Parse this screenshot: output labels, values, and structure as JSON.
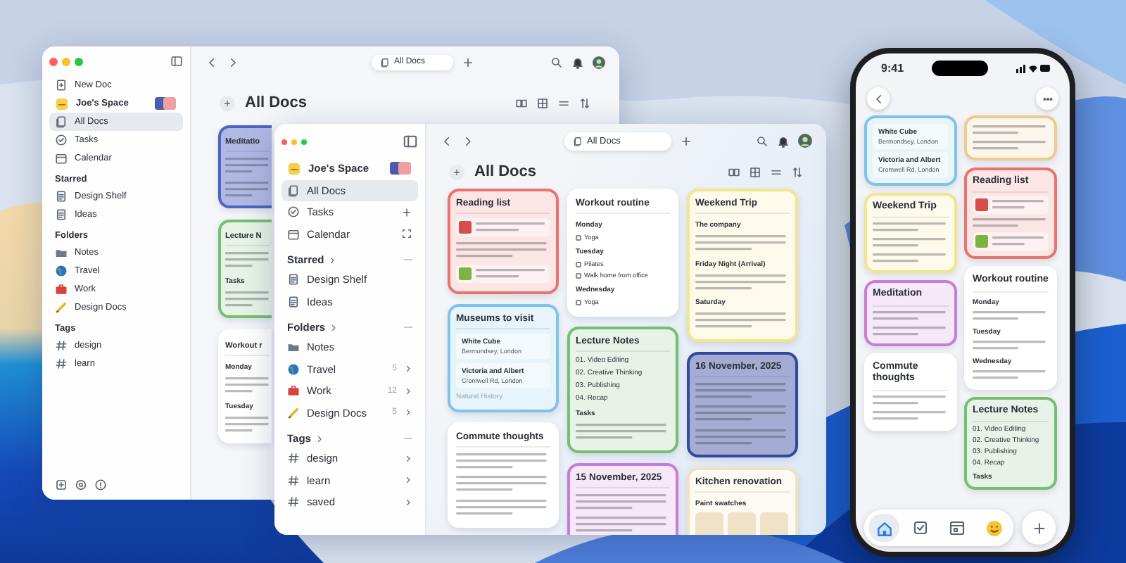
{
  "back_window": {
    "sidebar": {
      "new_doc": "New Doc",
      "space": "Joe's Space",
      "nav": [
        {
          "label": "All Docs",
          "kind": "docs",
          "selected": true
        },
        {
          "label": "Tasks",
          "kind": "tasks",
          "selected": false
        },
        {
          "label": "Calendar",
          "kind": "calendar",
          "selected": false
        }
      ],
      "sections": [
        {
          "title": "Starred",
          "collapsible": false,
          "items": [
            {
              "label": "Design Shelf",
              "kind": "doc"
            },
            {
              "label": "Ideas",
              "kind": "doc"
            }
          ]
        },
        {
          "title": "Folders",
          "collapsible": false,
          "items": [
            {
              "label": "Notes",
              "kind": "folder"
            },
            {
              "label": "Travel",
              "kind": "globe"
            },
            {
              "label": "Work",
              "kind": "briefcase"
            },
            {
              "label": "Design Docs",
              "kind": "pencil"
            }
          ]
        },
        {
          "title": "Tags",
          "collapsible": false,
          "items": [
            {
              "label": "design",
              "kind": "hash"
            },
            {
              "label": "learn",
              "kind": "hash"
            }
          ]
        }
      ]
    },
    "tab": "All Docs",
    "heading": "All Docs",
    "cards": [
      {
        "title": "Meditatio",
        "color": "#4f63c4",
        "items": [
          {
            "kind": "blurb"
          },
          {
            "kind": "blurb"
          }
        ]
      },
      {
        "title": "Lecture N",
        "color": "#74bf72",
        "items": [
          {
            "kind": "blurb"
          },
          {
            "kind": "label",
            "text": "Tasks"
          },
          {
            "kind": "blurb"
          }
        ]
      },
      {
        "title": "Workout r",
        "color": "#ffffff",
        "items": [
          {
            "kind": "label",
            "text": "Monday"
          },
          {
            "kind": "blurb"
          },
          {
            "kind": "label",
            "text": "Tuesday"
          },
          {
            "kind": "blurb"
          }
        ]
      }
    ]
  },
  "front_window": {
    "sidebar": {
      "space": "Joe's Space",
      "nav": [
        {
          "label": "All Docs",
          "kind": "docs",
          "selected": true
        },
        {
          "label": "Tasks",
          "kind": "tasks",
          "selected": false,
          "accessory": {
            "kind": "add"
          }
        },
        {
          "label": "Calendar",
          "kind": "calendar",
          "selected": false,
          "accessory": {
            "kind": "scan"
          }
        }
      ],
      "sections": [
        {
          "title": "Starred",
          "collapsible": true,
          "items": [
            {
              "label": "Design Shelf",
              "kind": "doc"
            },
            {
              "label": "Ideas",
              "kind": "doc"
            }
          ]
        },
        {
          "title": "Folders",
          "collapsible": true,
          "items": [
            {
              "label": "Notes",
              "kind": "folder"
            },
            {
              "label": "Travel",
              "kind": "globe",
              "count": "5"
            },
            {
              "label": "Work",
              "kind": "briefcase",
              "count": "12"
            },
            {
              "label": "Design Docs",
              "kind": "pencil",
              "count": "5"
            }
          ]
        },
        {
          "title": "Tags",
          "collapsible": true,
          "items": [
            {
              "label": "design",
              "kind": "hash"
            },
            {
              "label": "learn",
              "kind": "hash"
            },
            {
              "label": "saved",
              "kind": "hash"
            }
          ]
        }
      ]
    },
    "tab": "All Docs",
    "heading": "All Docs",
    "columns": [
      [
        {
          "title": "Reading list",
          "color": "#e8736f",
          "items": [
            {
              "kind": "book",
              "color": "#d64d4d"
            },
            {
              "kind": "blurb"
            },
            {
              "kind": "book",
              "color": "#7cb342"
            }
          ]
        },
        {
          "title": "Museums to visit",
          "color": "#7cc4e8",
          "items": [
            {
              "kind": "place",
              "text": "White Cube",
              "subtext": "Bermondsey, London"
            },
            {
              "kind": "place",
              "text": "Victoria and Albert",
              "subtext": "Cromwell Rd, London"
            },
            {
              "kind": "faded",
              "text": "Natural History"
            }
          ]
        },
        {
          "title": "Commute thoughts",
          "color": "#ffffff",
          "items": [
            {
              "kind": "blurb"
            },
            {
              "kind": "blurb"
            },
            {
              "kind": "blurb"
            }
          ]
        }
      ],
      [
        {
          "title": "Workout routine",
          "color": "#ffffff",
          "items": [
            {
              "kind": "label",
              "text": "Monday"
            },
            {
              "kind": "check",
              "text": "Yoga",
              "checked": false
            },
            {
              "kind": "label",
              "text": "Tuesday"
            },
            {
              "kind": "check",
              "text": "Pilates",
              "checked": false
            },
            {
              "kind": "check",
              "text": "Walk home from office",
              "checked": false
            },
            {
              "kind": "label",
              "text": "Wednesday"
            },
            {
              "kind": "check",
              "text": "Yoga",
              "checked": false
            }
          ]
        },
        {
          "title": "Lecture Notes",
          "color": "#74bf72",
          "items": [
            {
              "kind": "numbered",
              "text": "01. Video Editing"
            },
            {
              "kind": "numbered",
              "text": "02. Creative Thinking"
            },
            {
              "kind": "numbered",
              "text": "03. Publishing"
            },
            {
              "kind": "numbered",
              "text": "04. Recap"
            },
            {
              "kind": "label",
              "text": "Tasks"
            },
            {
              "kind": "blurb"
            }
          ]
        },
        {
          "title": "15 November, 2025",
          "color": "#c77dd8",
          "items": [
            {
              "kind": "blurb"
            },
            {
              "kind": "blurb"
            }
          ]
        }
      ],
      [
        {
          "title": "Weekend Trip",
          "color": "#f3e48e",
          "items": [
            {
              "kind": "label",
              "text": "The company"
            },
            {
              "kind": "blurb"
            },
            {
              "kind": "label",
              "text": "Friday Night (Arrival)"
            },
            {
              "kind": "blurb"
            },
            {
              "kind": "label",
              "text": "Saturday"
            },
            {
              "kind": "blurb"
            }
          ]
        },
        {
          "title": "16 November, 2025",
          "color": "#34479e",
          "items": [
            {
              "kind": "blurb"
            },
            {
              "kind": "blurb"
            },
            {
              "kind": "blurb"
            }
          ]
        },
        {
          "title": "Kitchen renovation",
          "color": "#f0e2bf",
          "items": [
            {
              "kind": "label",
              "text": "Paint swatches"
            },
            {
              "kind": "swatches"
            }
          ]
        }
      ]
    ]
  },
  "phone": {
    "time": "9:41",
    "columns": [
      [
        {
          "color": "#7cc4e8",
          "items": [
            {
              "kind": "place",
              "text": "White Cube",
              "subtext": "Bermondsey, London"
            },
            {
              "kind": "place",
              "text": "Victoria and Albert",
              "subtext": "Cromwell Rd, London"
            }
          ]
        },
        {
          "title": "Weekend Trip",
          "color": "#f3e48e",
          "items": [
            {
              "kind": "blurb"
            },
            {
              "kind": "blurb"
            },
            {
              "kind": "blurb"
            }
          ]
        },
        {
          "title": "Meditation",
          "color": "#c77dd8",
          "items": [
            {
              "kind": "blurb"
            },
            {
              "kind": "blurb"
            }
          ]
        },
        {
          "title": "Commute thoughts",
          "color": "#ffffff",
          "items": [
            {
              "kind": "blurb"
            },
            {
              "kind": "blurb"
            }
          ]
        }
      ],
      [
        {
          "color": "#f0c98f",
          "items": [
            {
              "kind": "blurb"
            },
            {
              "kind": "blurb"
            }
          ]
        },
        {
          "title": "Reading list",
          "color": "#e8736f",
          "items": [
            {
              "kind": "book",
              "color": "#d64d4d"
            },
            {
              "kind": "blurb"
            },
            {
              "kind": "book",
              "color": "#7cb342"
            }
          ]
        },
        {
          "title": "Workout routine",
          "color": "#ffffff",
          "items": [
            {
              "kind": "label",
              "text": "Monday"
            },
            {
              "kind": "blurb"
            },
            {
              "kind": "label",
              "text": "Tuesday"
            },
            {
              "kind": "blurb"
            },
            {
              "kind": "label",
              "text": "Wednesday"
            },
            {
              "kind": "blurb"
            }
          ]
        },
        {
          "title": "Lecture Notes",
          "color": "#74bf72",
          "items": [
            {
              "kind": "numbered",
              "text": "01. Video Editing"
            },
            {
              "kind": "numbered",
              "text": "02. Creative Thinking"
            },
            {
              "kind": "numbered",
              "text": "03. Publishing"
            },
            {
              "kind": "numbered",
              "text": "04. Recap"
            },
            {
              "kind": "label",
              "text": "Tasks"
            }
          ]
        }
      ]
    ],
    "tab_bar": [
      {
        "kind": "home",
        "selected": true
      },
      {
        "kind": "checklist",
        "selected": false
      },
      {
        "kind": "calendar",
        "selected": false
      },
      {
        "kind": "emoji",
        "selected": false
      }
    ]
  }
}
